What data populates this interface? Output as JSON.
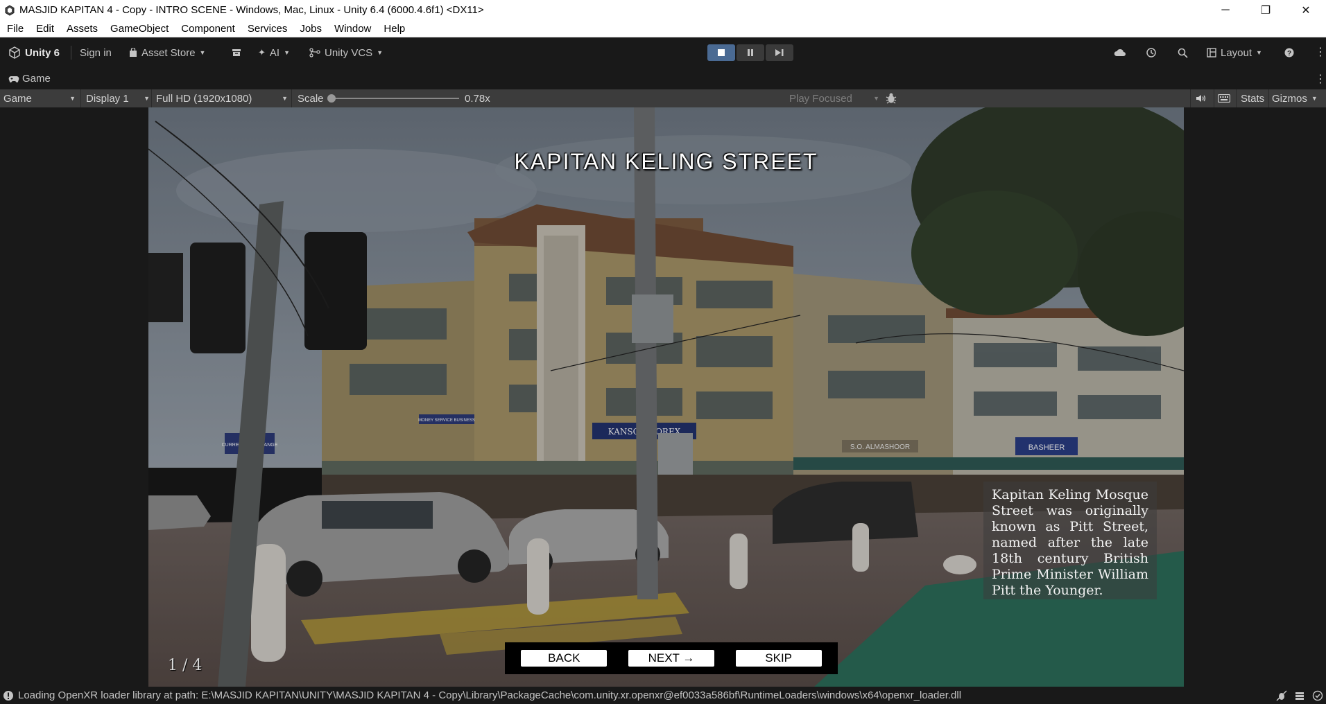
{
  "window": {
    "title": "MASJID KAPITAN 4 - Copy - INTRO SCENE - Windows, Mac, Linux - Unity 6.4 (6000.4.6f1) <DX11>",
    "minimize": "─",
    "maximize": "❐",
    "close": "✕"
  },
  "menu": [
    "File",
    "Edit",
    "Assets",
    "GameObject",
    "Component",
    "Services",
    "Jobs",
    "Window",
    "Help"
  ],
  "toolbar": {
    "brand": "Unity 6",
    "sign_in": "Sign in",
    "asset_store": "Asset Store",
    "ai": "AI",
    "vcs": "Unity VCS",
    "layout": "Layout"
  },
  "tab": {
    "label": "Game"
  },
  "game_toolbar": {
    "view_mode": "Game",
    "display": "Display 1",
    "resolution": "Full HD (1920x1080)",
    "scale_label": "Scale",
    "scale_value": "0.78x",
    "scale_fraction": 0.0,
    "play_mode": "Play Focused",
    "stats": "Stats",
    "gizmos": "Gizmos"
  },
  "scene": {
    "title": "KAPITAN KELING STREET",
    "info": "Kapitan Keling Mosque Street was originally known as Pitt Street, named after the late 18th century British Prime Minister William Pitt the Younger.",
    "pager": "1 / 4",
    "back": "BACK",
    "next": "NEXT →",
    "skip": "SKIP",
    "shop_signs": [
      "KANSON FOREX",
      "S.O. ALMASHOOR",
      "BASHEER",
      "CURRENCY EXCHANGE",
      "MONEY SERVICE BUSINESS"
    ]
  },
  "status": {
    "message": "Loading OpenXR loader library at path: E:\\MASJID KAPITAN\\UNITY\\MASJID KAPITAN 4 - Copy\\Library\\PackageCache\\com.unity.xr.openxr@ef0033a586bf\\RuntimeLoaders\\windows\\x64\\openxr_loader.dll"
  },
  "colors": {
    "editor_bg": "#191919",
    "toolbar_bg": "#3c3c3c",
    "play_active": "#4a6a93"
  }
}
